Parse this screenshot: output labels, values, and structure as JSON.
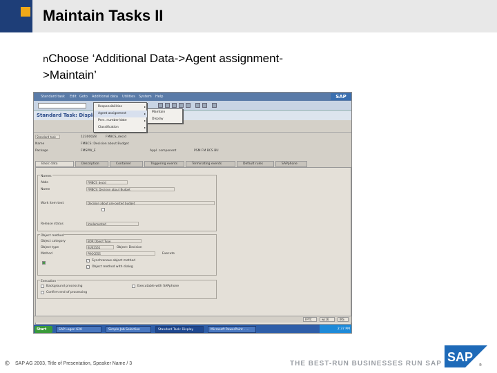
{
  "slide": {
    "title": "Maintain Tasks II",
    "bullet_marker": "n",
    "bullet_text": "Choose ‘Additional Data->Agent assignment->Maintain’"
  },
  "screenshot": {
    "menu": [
      "Standard task",
      "Edit",
      "Goto",
      "Additional data",
      "Utilities",
      "System",
      "Help"
    ],
    "sap_logo": "SAP",
    "app_title": "Standard Task: Display",
    "header_fields": [
      {
        "label": "Standard task",
        "value": "12300028",
        "extra": "FMBCS_decid"
      },
      {
        "label": "Name",
        "value": "FMBCS: Decision about Budget"
      },
      {
        "label": "Package",
        "value": "FMSPW_E",
        "label2": "Appl. component",
        "value2": "PSM FM BCS BU"
      }
    ],
    "dropdown": [
      {
        "label": "Responsibilities",
        "arrow": "▸"
      },
      {
        "label": "Agent assignment",
        "arrow": "▸"
      },
      {
        "label": "Pers. number/date",
        "arrow": "▸"
      },
      {
        "label": "Classification",
        "arrow": "▸"
      }
    ],
    "submenu": [
      "Maintain",
      "Display"
    ],
    "tabs": [
      "Basic data",
      "Description",
      "Container",
      "Triggering events",
      "Terminating events",
      "Default rules",
      "SAPphone"
    ],
    "groups": {
      "names": "Names",
      "object_method": "Object method",
      "execution": "Execution"
    },
    "names_fields": [
      {
        "label": "Abbr.",
        "value": "FMBCS_decid"
      },
      {
        "label": "Name",
        "value": "FMBCS: Decision about Budget"
      },
      {
        "label": "Work item text",
        "value": "Decision about pre-posted budget"
      },
      {
        "label": "Release status",
        "value": "Implemented"
      }
    ],
    "object_fields": [
      {
        "label": "Object category",
        "value": "BOR Object Type"
      },
      {
        "label": "Object type",
        "value": "BUS2161",
        "extra": "Object: Decision"
      },
      {
        "label": "Method",
        "value": "PROCESS",
        "extra": "Execute"
      }
    ],
    "object_checks": [
      "Synchronous object method",
      "Object method with dialog"
    ],
    "exec_checks": [
      "Background processing",
      "Confirm end of processing"
    ],
    "exec_checks_right": [
      "Executable with SAPphone"
    ],
    "status": {
      "sys": "FPTC",
      "client": "ws16",
      "mode": "INS"
    },
    "taskbar": {
      "start": "Start",
      "tasks": [
        "SAP Logon 620",
        "Simple Job Selection",
        "Standard Task: Display",
        "Microsoft PowerPoint - ..."
      ],
      "time": "2:37 PM"
    }
  },
  "footer": {
    "copyright_symbol": "©",
    "text": "SAP AG 2003, Title of Presentation, Speaker Name / 3",
    "tagline": "THE BEST-RUN BUSINESSES RUN SAP",
    "logo_text": "SAP",
    "logo_mark": "®"
  },
  "colors": {
    "title_accent": "#1e3e78",
    "title_square": "#f0a818",
    "sap_blue": "#1e6ab8"
  }
}
